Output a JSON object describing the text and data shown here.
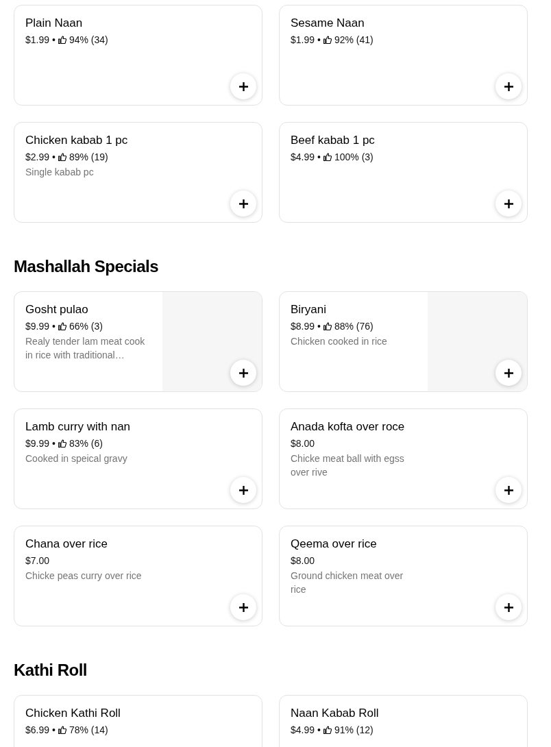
{
  "sections": [
    {
      "items": [
        {
          "name": "Plain Naan",
          "price": "$1.99",
          "separator": "•",
          "rating": "94% (34)",
          "add_button": true
        },
        {
          "name": "Sesame Naan",
          "price": "$1.99",
          "separator": "•",
          "rating": "92% (41)",
          "add_button": true
        },
        {
          "name": "Chicken kabab 1 pc",
          "price": "$2.99",
          "separator": "•",
          "rating": "89% (19)",
          "description": "Single kabab pc",
          "add_button": true
        },
        {
          "name": "Beef kabab 1 pc",
          "price": "$4.99",
          "separator": "•",
          "rating": "100% (3)",
          "add_button": true
        }
      ]
    },
    {
      "title": "Mashallah Specials",
      "items": [
        {
          "name": "Gosht pulao",
          "price": "$9.99",
          "separator": "•",
          "rating": "66% (3)",
          "description": "Realy tender lam meat cook in rice with traditional…",
          "add_button": true
        },
        {
          "name": "Biryani",
          "price": "$8.99",
          "separator": "•",
          "rating": "88% (76)",
          "description": "Chicken cooked in rice",
          "add_button": true
        },
        {
          "name": "Lamb curry with nan",
          "price": "$9.99",
          "separator": "•",
          "rating": "83% (6)",
          "description": "Cooked in speical gravy",
          "add_button": true
        },
        {
          "name": "Anada kofta over roce",
          "price": "$8.00",
          "description": "Chicke meat ball with egss over rive",
          "add_button": true
        },
        {
          "name": "Chana over rice",
          "price": "$7.00",
          "description": "Chicke peas curry over rice",
          "add_button": true
        },
        {
          "name": "Qeema over rice",
          "price": "$8.00",
          "description": "Ground chicken meat over rice",
          "add_button": true
        }
      ]
    },
    {
      "title": "Kathi Roll",
      "items": [
        {
          "name": "Chicken Kathi Roll",
          "price": "$6.99",
          "separator": "•",
          "rating": "78% (14)"
        },
        {
          "name": "Naan Kabab Roll",
          "price": "$4.99",
          "separator": "•",
          "rating": "91% (12)"
        }
      ]
    }
  ]
}
